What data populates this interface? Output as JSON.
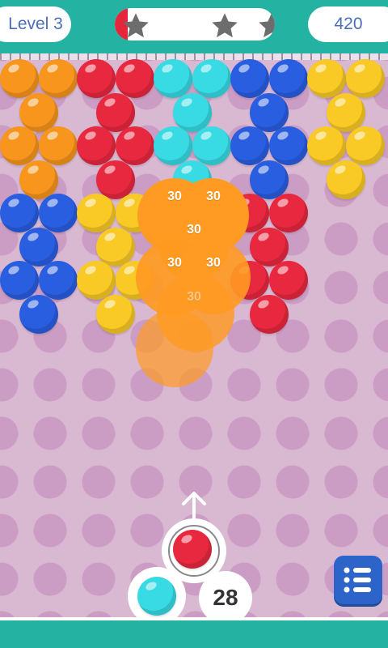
{
  "level_label": "Level 3",
  "score": "420",
  "progress": 0.08,
  "stars_earned": 0,
  "stars_total": 3,
  "colors": {
    "orange": "#f7951d",
    "red": "#e8283f",
    "cyan": "#38dbe4",
    "blue": "#2a5ee0",
    "yellow": "#f9c925",
    "pop": "#ff9a22",
    "teal": "#24b3a2",
    "star_gray": "#6d6d6d"
  },
  "bubble_grid": [
    [
      "orange",
      "orange",
      "red",
      "red",
      "cyan",
      "cyan",
      "blue",
      "blue",
      "yellow",
      "yellow"
    ],
    [
      "orange",
      "red",
      "cyan",
      "blue",
      "yellow"
    ],
    [
      "orange",
      "orange",
      "red",
      "red",
      "cyan",
      "cyan",
      "blue",
      "blue",
      "yellow",
      "yellow"
    ],
    [
      "orange",
      "red",
      "cyan",
      "blue",
      "yellow"
    ],
    [
      "blue",
      "blue",
      "yellow",
      "yellow",
      "",
      "",
      "red",
      "red"
    ],
    [
      "blue",
      "yellow",
      "",
      "red"
    ],
    [
      "blue",
      "blue",
      "yellow",
      "yellow",
      "",
      "",
      "red",
      "red"
    ],
    [
      "blue",
      "yellow",
      "",
      "red"
    ]
  ],
  "pop_points": [
    "30",
    "30",
    "30",
    "30",
    "30",
    "30"
  ],
  "shooter_color": "red",
  "next_color": "cyan",
  "shots_left": "28",
  "menu_icon": "list-icon",
  "aim_icon": "arrow-up-icon"
}
